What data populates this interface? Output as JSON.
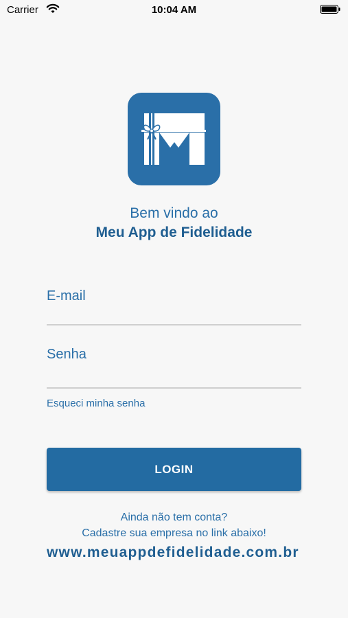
{
  "status_bar": {
    "carrier": "Carrier",
    "time": "10:04 AM",
    "icons": [
      "wifi-icon",
      "battery-icon"
    ]
  },
  "logo": {
    "icon": "gift-m-logo",
    "color": "#2a6fa8"
  },
  "welcome": {
    "line1": "Bem vindo ao",
    "line2": "Meu App de Fidelidade"
  },
  "form": {
    "email_label": "E-mail",
    "password_label": "Senha",
    "forgot_password": "Esqueci minha senha",
    "login_button": "LOGIN"
  },
  "signup": {
    "question": "Ainda não tem conta?",
    "hint": "Cadastre sua empresa no link abaixo!",
    "link": "www.meuappdefidelidade.com.br"
  },
  "colors": {
    "primary": "#236ba2",
    "text_primary": "#2a6fa8",
    "background": "#f7f7f7"
  }
}
